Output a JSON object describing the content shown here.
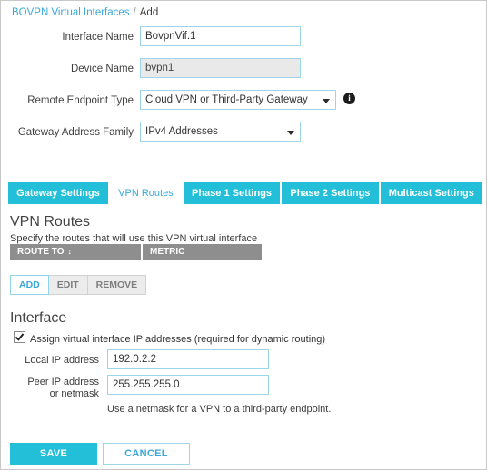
{
  "breadcrumb": {
    "root": "BOVPN Virtual Interfaces",
    "separator": "/",
    "current": "Add"
  },
  "colors": {
    "accent_teal": "#23bfd8",
    "link_blue": "#3aa8d8",
    "field_border": "#9cd6e8",
    "table_header_gray": "#8e8e8e"
  },
  "form": {
    "fields": [
      {
        "label": "Interface Name",
        "value": "BovpnVif.1",
        "type": "text",
        "disabled": false
      },
      {
        "label": "Device Name",
        "value": "bvpn1",
        "type": "text",
        "disabled": true
      },
      {
        "label": "Remote Endpoint Type",
        "value": "Cloud VPN or Third-Party Gateway",
        "type": "select",
        "has_info": true
      },
      {
        "label": "Gateway Address Family",
        "value": "IPv4 Addresses",
        "type": "select",
        "has_info": false
      }
    ],
    "info_icon_glyph": "i"
  },
  "tabs": [
    {
      "label": "Gateway Settings",
      "active": false
    },
    {
      "label": "VPN Routes",
      "active": true
    },
    {
      "label": "Phase 1 Settings",
      "active": false
    },
    {
      "label": "Phase 2 Settings",
      "active": false
    },
    {
      "label": "Multicast Settings",
      "active": false
    }
  ],
  "vpn_routes": {
    "title": "VPN Routes",
    "description": "Specify the routes that will use this VPN virtual interface",
    "columns": [
      {
        "label": "ROUTE TO",
        "sortable": true,
        "sort_glyph": "↕"
      },
      {
        "label": "METRIC",
        "sortable": false,
        "sort_glyph": ""
      }
    ],
    "rows": [],
    "actions": [
      {
        "label": "ADD",
        "enabled": true
      },
      {
        "label": "EDIT",
        "enabled": false
      },
      {
        "label": "REMOVE",
        "enabled": false
      }
    ]
  },
  "interface_section": {
    "title": "Interface",
    "checkbox": {
      "label": "Assign virtual interface IP addresses (required for dynamic routing)",
      "checked": true
    },
    "local_ip": {
      "label": "Local IP address",
      "value": "192.0.2.2"
    },
    "peer_ip": {
      "label": "Peer IP address or netmask",
      "value": "255.255.255.0"
    },
    "hint": "Use a netmask for a VPN to a third-party endpoint."
  },
  "footer": {
    "save_label": "SAVE",
    "cancel_label": "CANCEL"
  }
}
